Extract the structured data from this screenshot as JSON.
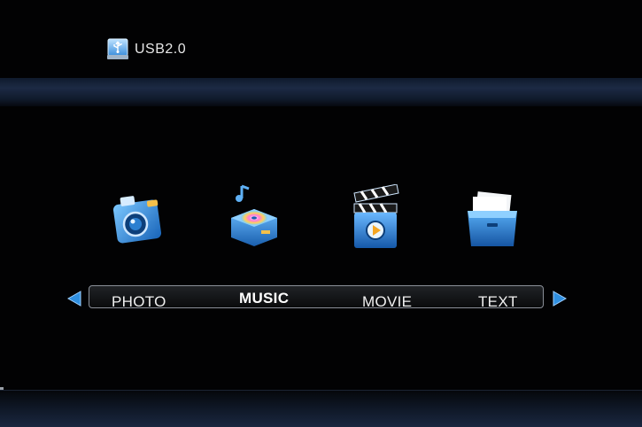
{
  "header": {
    "device_label": "USB2.0",
    "device_icon": "usb-drive-icon"
  },
  "menu": {
    "items": [
      {
        "label": "PHOTO",
        "icon": "photo-camera-icon"
      },
      {
        "label": "MUSIC",
        "icon": "music-player-icon",
        "selected": true
      },
      {
        "label": "MOVIE",
        "icon": "movie-clapper-icon"
      },
      {
        "label": "TEXT",
        "icon": "text-folder-icon"
      }
    ],
    "left_arrow_icon": "arrow-left-icon",
    "right_arrow_icon": "arrow-right-icon"
  },
  "colors": {
    "accent_blue": "#2f8fe0",
    "background": "#020203",
    "band_blue": "#1c2a44"
  }
}
